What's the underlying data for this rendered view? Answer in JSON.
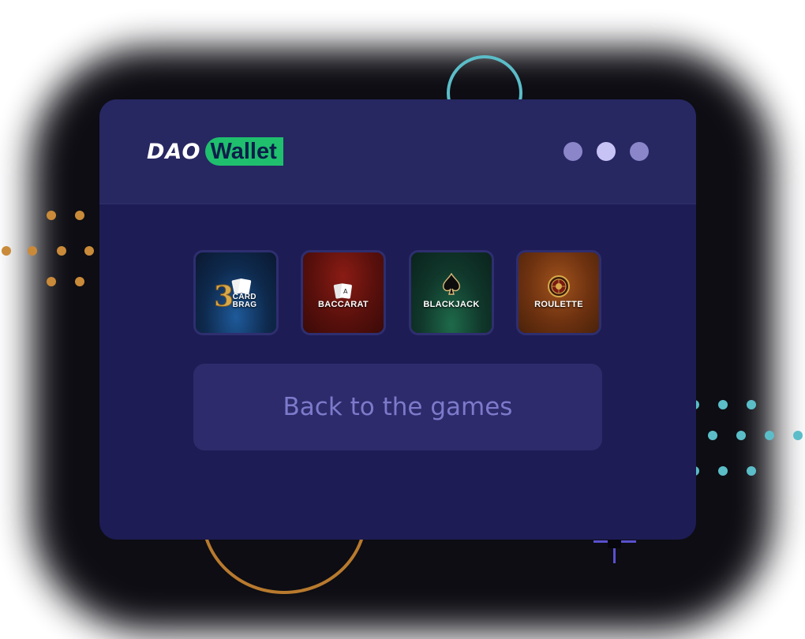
{
  "logo": {
    "part1": "DAO",
    "part2": "Wallet"
  },
  "window_controls": [
    "dot",
    "dot",
    "dot"
  ],
  "games": [
    {
      "name": "3 CARD BRAG",
      "label_line1": "3",
      "label_line2": "CARD",
      "label_line3": "BRAG",
      "icon": "cards-icon"
    },
    {
      "name": "BACCARAT",
      "label": "BACCARAT",
      "icon": "cards-icon"
    },
    {
      "name": "BLACKJACK",
      "label": "BLACKJACK",
      "icon": "spade-icon"
    },
    {
      "name": "ROULETTE",
      "label": "ROULETTE",
      "icon": "roulette-wheel-icon"
    }
  ],
  "back_button": {
    "label": "Back to the games"
  },
  "colors": {
    "window_bg": "#1d1c54",
    "titlebar_bg": "#272762",
    "accent_green": "#1fbf6e",
    "button_bg": "#2d2b6b",
    "button_text": "#7d7acb"
  }
}
